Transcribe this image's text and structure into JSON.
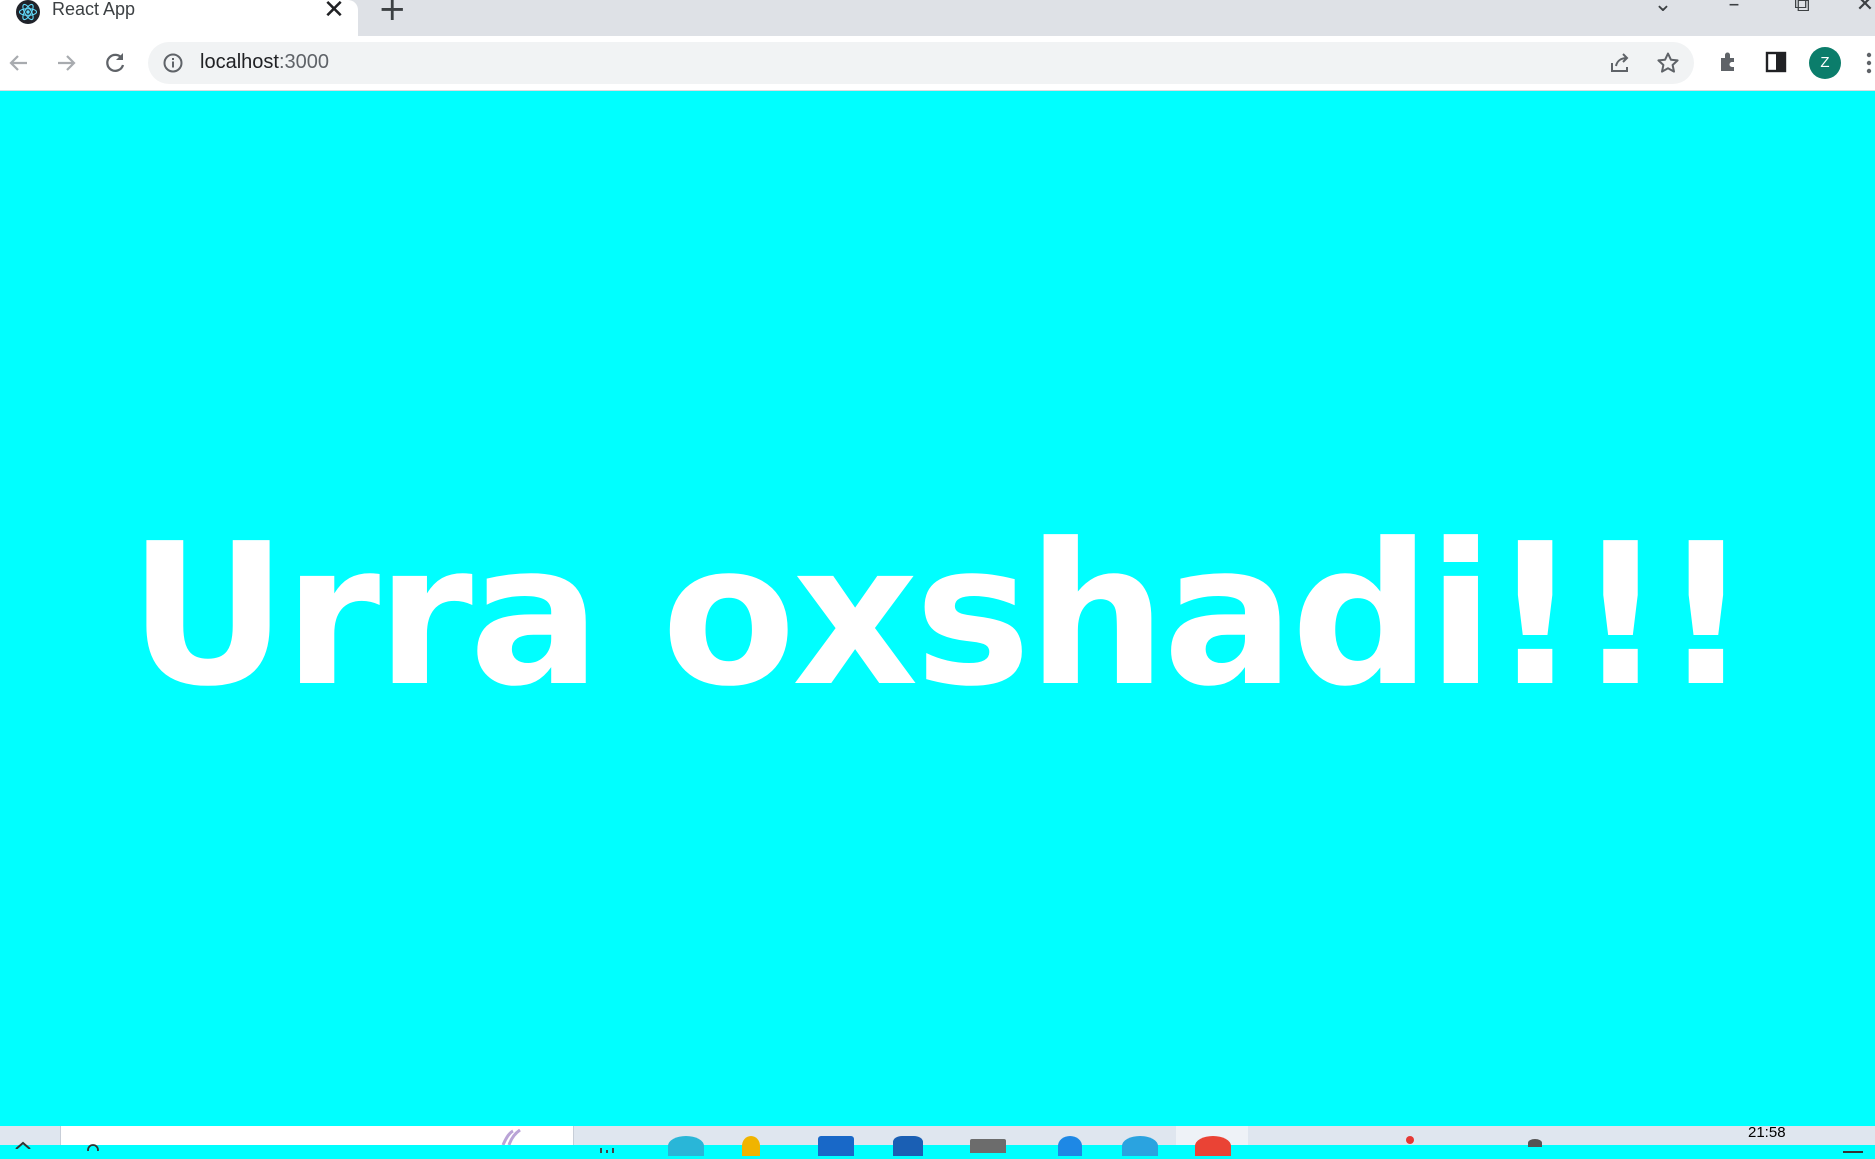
{
  "browser": {
    "tab": {
      "title": "React App",
      "close_glyph": "✕",
      "favicon": "react-icon"
    },
    "new_tab_glyph": "+",
    "window_controls": {
      "tab_search_glyph": "⌄",
      "minimize_glyph": "–",
      "restore_glyph": "⧉",
      "close_glyph": "✕"
    },
    "toolbar": {
      "back_icon": "arrow-left-icon",
      "forward_icon": "arrow-right-icon",
      "reload_icon": "reload-icon",
      "share_icon": "share-icon",
      "bookmark_icon": "star-icon",
      "extensions_icon": "puzzle-icon",
      "side_panel_icon": "side-panel-icon"
    },
    "omnibox": {
      "host": "localhost",
      "port": ":3000"
    },
    "profile": {
      "initial": "Z",
      "color": "#0b7d6b"
    }
  },
  "page": {
    "background_color": "#00ffff",
    "headline": "Urra oxshadi!!!",
    "headline_color": "#ffffff"
  },
  "taskbar": {
    "time": "21:58"
  }
}
